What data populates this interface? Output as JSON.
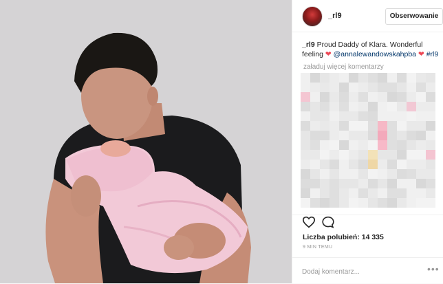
{
  "post": {
    "username": "_rl9",
    "follow_label": "Obserwowanie",
    "caption": {
      "author": "_rl9",
      "text": "Proud Daddy of Klara. Wonderful feeling",
      "mention": "@annalewandowskahpba",
      "hashtag": "#rl9"
    },
    "load_more_label": "załaduj więcej komentarzy",
    "likes_label": "Liczba polubień: 14 335",
    "time_label": "9 MIN TEMU",
    "comment_placeholder": "Dodaj komentarz...",
    "more_options_icon": "ellipsis-icon"
  },
  "colors": {
    "heart": "#ed4956",
    "mention": "#003569",
    "muted": "#999999"
  },
  "icons": {
    "like": "heart-outline-icon",
    "comment": "speech-bubble-icon"
  }
}
